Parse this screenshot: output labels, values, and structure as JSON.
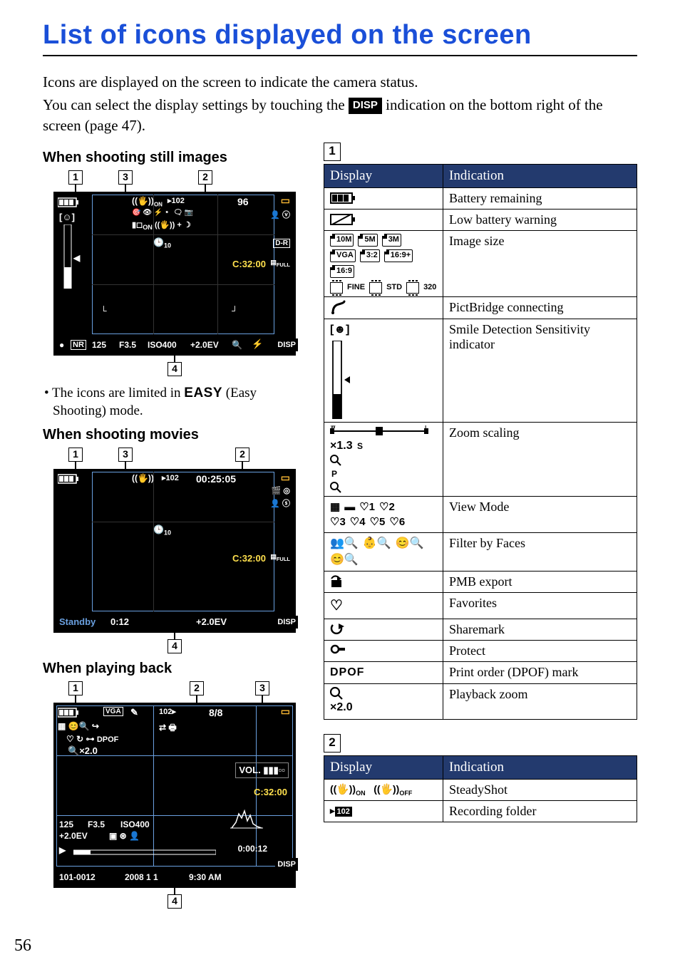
{
  "title": "List of icons displayed on the screen",
  "intro1": "Icons are displayed on the screen to indicate the camera status.",
  "intro2a": "You can select the display settings by touching the ",
  "intro2b": " indication on the bottom right of the screen (page 47).",
  "disp_label": "DISP",
  "headings": {
    "still": "When shooting still images",
    "movie": "When shooting movies",
    "playback": "When playing back"
  },
  "callout_labels": {
    "c1": "1",
    "c2": "2",
    "c3": "3",
    "c4": "4"
  },
  "note_parts": {
    "prefix": "• The icons are limited in ",
    "easy": "EASY",
    "suffix": " (Easy Shooting) mode."
  },
  "lcd_still": {
    "count": "96",
    "timer": "C:32:00",
    "self_timer": "10",
    "shutter": "125",
    "fnum": "F3.5",
    "iso": "ISO400",
    "ev": "+2.0EV",
    "dr": "D-R",
    "nr": "NR",
    "folder": "102",
    "on": "ON",
    "plus": "+",
    "full": "FULL",
    "disp": "DISP"
  },
  "lcd_movie": {
    "rec_time": "00:25:05",
    "timer": "C:32:00",
    "self_timer": "10",
    "ev": "+2.0EV",
    "standby": "Standby",
    "elapsed": "0:12",
    "folder": "102",
    "full": "FULL",
    "disp": "DISP"
  },
  "lcd_playback": {
    "size": "VGA",
    "folder": "102",
    "counter": "8/8",
    "dpof": "DPOF",
    "zoom": "×2.0",
    "vol": "VOL.",
    "timer": "C:32:00",
    "shutter": "125",
    "fnum": "F3.5",
    "iso": "ISO400",
    "ev": "+2.0EV",
    "play_time": "0:00:12",
    "filenum": "101-0012",
    "date": "2008  1  1",
    "time": "9:30 AM",
    "disp": "DISP"
  },
  "table_headers": {
    "display": "Display",
    "indication": "Indication"
  },
  "section_nums": {
    "s1": "1",
    "s2": "2"
  },
  "table1": {
    "battery": "Battery remaining",
    "low_batt": "Low battery warning",
    "imgsize": "Image size",
    "pictbridge": "PictBridge connecting",
    "smile": "Smile Detection Sensitivity indicator",
    "zoom": "Zoom scaling",
    "view_mode": "View Mode",
    "filter_faces": "Filter by Faces",
    "pmb": "PMB export",
    "favorites": "Favorites",
    "sharemark": "Sharemark",
    "protect": "Protect",
    "dpof": "Print order (DPOF) mark",
    "pbzoom": "Playback zoom"
  },
  "table1_icons": {
    "sizes_row1": [
      "10M",
      "5M",
      "3M"
    ],
    "sizes_row2": [
      "VGA",
      "3:2",
      "16:9+"
    ],
    "sizes_row3": [
      "16:9"
    ],
    "movie_row": [
      "FINE",
      "STD",
      "320"
    ],
    "zoom_text": "×1.3",
    "zoom_s": "S",
    "zoom_p": "P",
    "hearts": [
      "1",
      "2",
      "3",
      "4",
      "5",
      "6"
    ],
    "dpof_label": "DPOF",
    "pbzoom_label": "×2.0"
  },
  "table2": {
    "steadyshot": "SteadyShot",
    "recfolder": "Recording folder"
  },
  "table2_icons": {
    "on": "ON",
    "off": "OFF",
    "folder": "102"
  },
  "page_number": "56"
}
